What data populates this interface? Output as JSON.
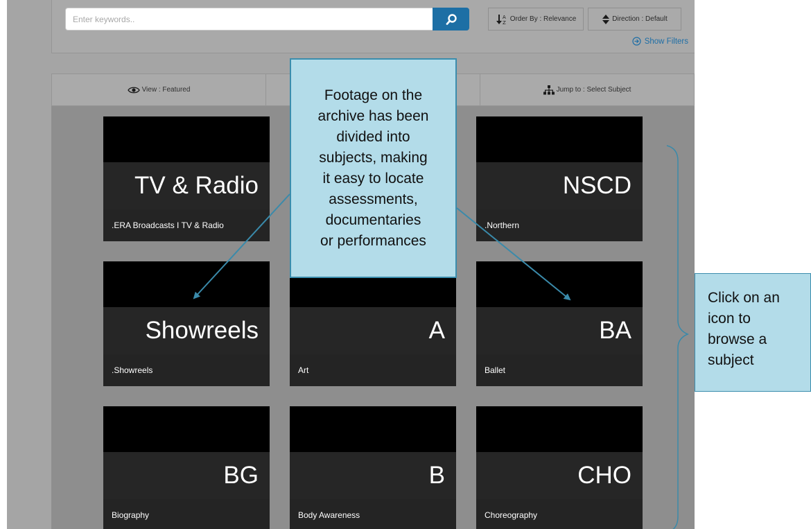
{
  "search": {
    "placeholder": "Enter keywords.."
  },
  "toolbar": {
    "order_label": "Order By : Relevance",
    "direction_label": "Direction : Default",
    "show_filters_label": "Show Filters"
  },
  "nav": {
    "view_label": "View : Featured",
    "jump_label": "Jump to : Select Subject"
  },
  "tiles": [
    {
      "abbr": "TV & Radio",
      "caption": ".ERA Broadcasts I TV & Radio"
    },
    {
      "abbr": "",
      "caption": ""
    },
    {
      "abbr": "NSCD",
      "caption": ".Northern"
    },
    {
      "abbr": "Showreels",
      "caption": ".Showreels"
    },
    {
      "abbr": "A",
      "caption": "Art"
    },
    {
      "abbr": "BA",
      "caption": "Ballet"
    },
    {
      "abbr": "BG",
      "caption": "Biography"
    },
    {
      "abbr": "B",
      "caption": "Body Awareness"
    },
    {
      "abbr": "CHO",
      "caption": "Choreography"
    }
  ],
  "annotations": {
    "main_lines": [
      "Footage on the",
      "archive has been",
      "divided into",
      "subjects, making",
      "it easy to locate",
      "assessments,",
      "documentaries",
      "or performances"
    ],
    "side_lines": [
      "Click on an",
      "icon to",
      "browse a",
      "subject"
    ]
  },
  "colors": {
    "accent": "#1d6fa5",
    "callout_fill": "#b3dce9",
    "callout_border": "#3b8dad",
    "tile_dark": "#000000",
    "tile_band": "#262626"
  }
}
